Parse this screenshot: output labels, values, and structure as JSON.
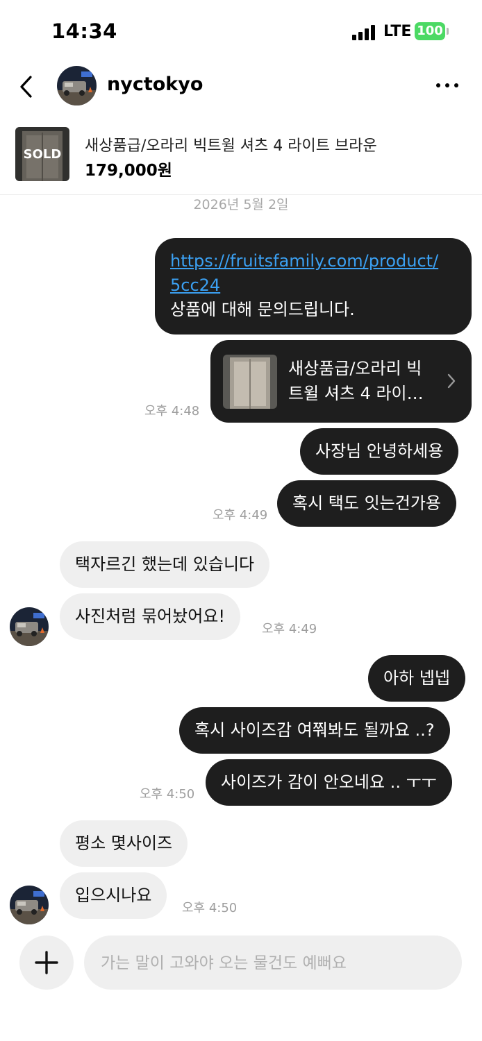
{
  "status_bar": {
    "time": "14:34",
    "network": "LTE",
    "battery": "100",
    "battery_color": "#4cd964"
  },
  "header": {
    "back_icon": "chevron-left-icon",
    "username": "nyctokyo",
    "more_icon": "more-horizontal-icon"
  },
  "product": {
    "sold_label": "SOLD",
    "title": "새상품급/오라리 빅트윌 셔츠 4 라이트 브라운",
    "price": "179,000원"
  },
  "date_label": "2026년 5월 2일",
  "messages": [
    {
      "from": "me",
      "link": "https://fruitsfamily.com/product/",
      "link2": "5cc24",
      "text": "상품에 대해 문의드립니다."
    },
    {
      "from": "me",
      "type": "product_card",
      "line1": "새상품급/오라리 빅",
      "line2": "트윌 셔츠 4 라이…",
      "time": "오후 4:48"
    },
    {
      "from": "me",
      "text": "사장님 안녕하세용"
    },
    {
      "from": "me",
      "text": "혹시 택도 잇는건가용",
      "time": "오후 4:49"
    },
    {
      "from": "them",
      "text": "택자르긴 했는데 있습니다"
    },
    {
      "from": "them",
      "text": "사진처럼 묶어놨어요!",
      "time": "오후 4:49"
    },
    {
      "from": "me",
      "text": "아하 넵넵"
    },
    {
      "from": "me",
      "text": "혹시 사이즈감 여쭤봐도 될까요 ..?"
    },
    {
      "from": "me",
      "text": "사이즈가 감이 안오네요 .. ㅜㅜ",
      "time": "오후 4:50"
    },
    {
      "from": "them",
      "text": "평소 몇사이즈"
    },
    {
      "from": "them",
      "text": "입으시나요",
      "time": "오후 4:50"
    }
  ],
  "composer": {
    "placeholder": "가는 말이 고와야 오는 물건도 예뻐요",
    "plus_icon": "plus-icon"
  },
  "colors": {
    "outgoing_bubble": "#1e1e1e",
    "incoming_bubble": "#efefef",
    "link": "#3ba0f2"
  }
}
